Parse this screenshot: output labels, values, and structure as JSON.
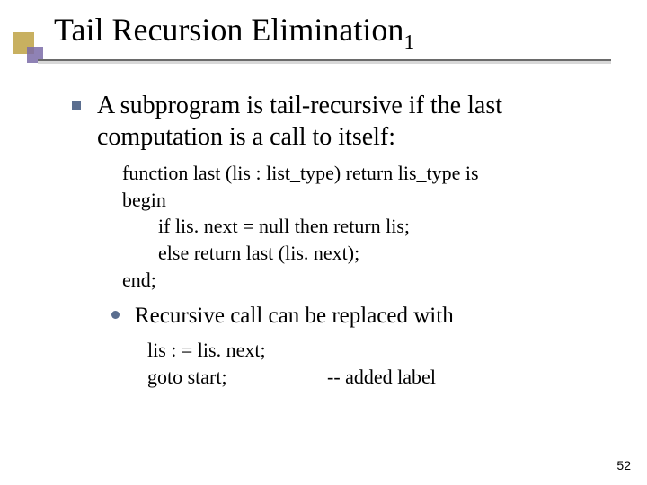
{
  "title": {
    "main": "Tail Recursion Elimination",
    "subscript": "1"
  },
  "bullets": {
    "lvl1_text": "A subprogram is tail-recursive if the last computation is a call to itself:",
    "code1": {
      "l1": "function last (lis : list_type) return lis_type is",
      "l2": "begin",
      "l3": "if lis. next = null then return lis;",
      "l4": "else return last (lis. next);",
      "l5": "end;"
    },
    "lvl2_text": "Recursive call can be replaced with",
    "code2": {
      "l1": "lis : = lis. next;",
      "l2a": "goto start;",
      "l2b": "--  added label"
    }
  },
  "page_number": "52"
}
